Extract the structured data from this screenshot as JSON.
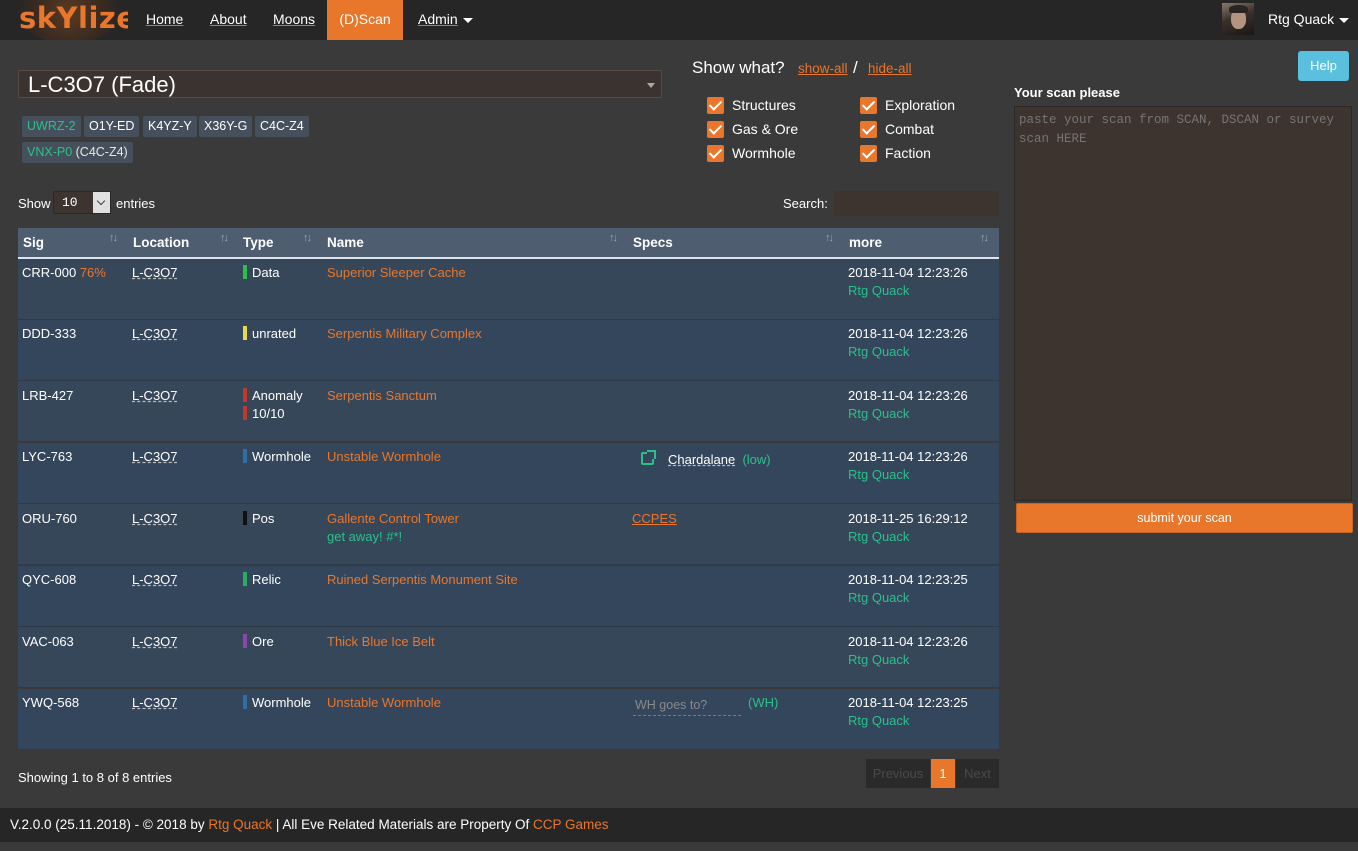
{
  "nav": {
    "logo": "skYlizer",
    "items": [
      {
        "label": "Home"
      },
      {
        "label": "About"
      },
      {
        "label": "Moons"
      },
      {
        "label": "(D)Scan",
        "active": true
      },
      {
        "label": "Admin"
      }
    ],
    "user": "Rtg Quack"
  },
  "system": {
    "selected": "L-C3O7 (Fade)",
    "neighbors": [
      "UWRZ-2",
      "O1Y-ED",
      "K4YZ-Y",
      "X36Y-G",
      "C4C-Z4"
    ],
    "extra_system": "VNX-P0",
    "extra_sub": "(C4C-Z4)"
  },
  "filters": {
    "title": "Show what?",
    "show_all": "show-all",
    "slash": "/",
    "hide_all": "hide-all",
    "options": [
      {
        "label": "Structures",
        "checked": true
      },
      {
        "label": "Exploration",
        "checked": true
      },
      {
        "label": "Gas & Ore",
        "checked": true
      },
      {
        "label": "Combat",
        "checked": true
      },
      {
        "label": "Wormhole",
        "checked": true
      },
      {
        "label": "Faction",
        "checked": true
      }
    ]
  },
  "help": "Help",
  "scan": {
    "title": "Your scan please",
    "placeholder": "paste your scan from SCAN, DSCAN or survey scan HERE",
    "submit": "submit your scan"
  },
  "table_controls": {
    "show": "Show",
    "entries_value": "10",
    "entries": "entries",
    "search": "Search:"
  },
  "table": {
    "columns": [
      "Sig",
      "Location",
      "Type",
      "Name",
      "Specs",
      "more"
    ],
    "rows": [
      {
        "sig": "CRR-000",
        "pct": "76%",
        "loc": "L-C3O7",
        "type": "Data",
        "type2": "",
        "type_color": "#2bc04a",
        "name": "Superior Sleeper Cache",
        "note": "",
        "spec": "",
        "date": "2018-11-04 12:23:26",
        "by": "Rtg Quack"
      },
      {
        "sig": "DDD-333",
        "pct": "",
        "loc": "L-C3O7",
        "type": "unrated",
        "type2": "",
        "type_color": "#e8d84a",
        "name": "Serpentis Military Complex",
        "note": "",
        "spec": "",
        "date": "2018-11-04 12:23:26",
        "by": "Rtg Quack"
      },
      {
        "sig": "LRB-427",
        "pct": "",
        "loc": "L-C3O7",
        "type": "Anomaly",
        "type2": "10/10",
        "type_color": "#c0392b",
        "name": "Serpentis Sanctum",
        "note": "",
        "spec": "",
        "date": "2018-11-04 12:23:26",
        "by": "Rtg Quack"
      },
      {
        "sig": "LYC-763",
        "pct": "",
        "loc": "L-C3O7",
        "type": "Wormhole",
        "type2": "",
        "type_color": "#2f6fa5",
        "name": "Unstable Wormhole",
        "note": "",
        "spec": "Chardalane",
        "spec_sec": "(low)",
        "date": "2018-11-04 12:23:26",
        "by": "Rtg Quack"
      },
      {
        "sig": "ORU-760",
        "pct": "",
        "loc": "L-C3O7",
        "type": "Pos",
        "type2": "",
        "type_color": "#111111",
        "name": "Gallente Control Tower",
        "note": "get away! #*!",
        "spec": "CCPES",
        "date": "2018-11-25 16:29:12",
        "by": "Rtg Quack"
      },
      {
        "sig": "QYC-608",
        "pct": "",
        "loc": "L-C3O7",
        "type": "Relic",
        "type2": "",
        "type_color": "#27ae60",
        "name": "Ruined Serpentis Monument Site",
        "note": "",
        "spec": "",
        "date": "2018-11-04 12:23:25",
        "by": "Rtg Quack"
      },
      {
        "sig": "VAC-063",
        "pct": "",
        "loc": "L-C3O7",
        "type": "Ore",
        "type2": "",
        "type_color": "#8e44ad",
        "name": "Thick Blue Ice Belt",
        "note": "",
        "spec": "",
        "date": "2018-11-04 12:23:26",
        "by": "Rtg Quack"
      },
      {
        "sig": "YWQ-568",
        "pct": "",
        "loc": "L-C3O7",
        "type": "Wormhole",
        "type2": "",
        "type_color": "#2f6fa5",
        "name": "Unstable Wormhole",
        "note": "",
        "spec": "",
        "wh_placeholder": "WH goes to?",
        "wh_tag": "(WH)",
        "date": "2018-11-04 12:23:25",
        "by": "Rtg Quack"
      }
    ]
  },
  "pagination": {
    "info": "Showing 1 to 8 of 8 entries",
    "previous": "Previous",
    "page": "1",
    "next": "Next"
  },
  "footer": {
    "prefix": "V.2.0.0 (25.11.2018) - © 2018 by ",
    "author": "Rtg Quack",
    "middle": " | All Eve Related Materials are Property Of ",
    "ccp": "CCP Games"
  },
  "colors": {
    "accent": "#e8762b",
    "highlight": "#2bc08a",
    "navbar": "#262626",
    "table_header": "#4e5d70"
  }
}
